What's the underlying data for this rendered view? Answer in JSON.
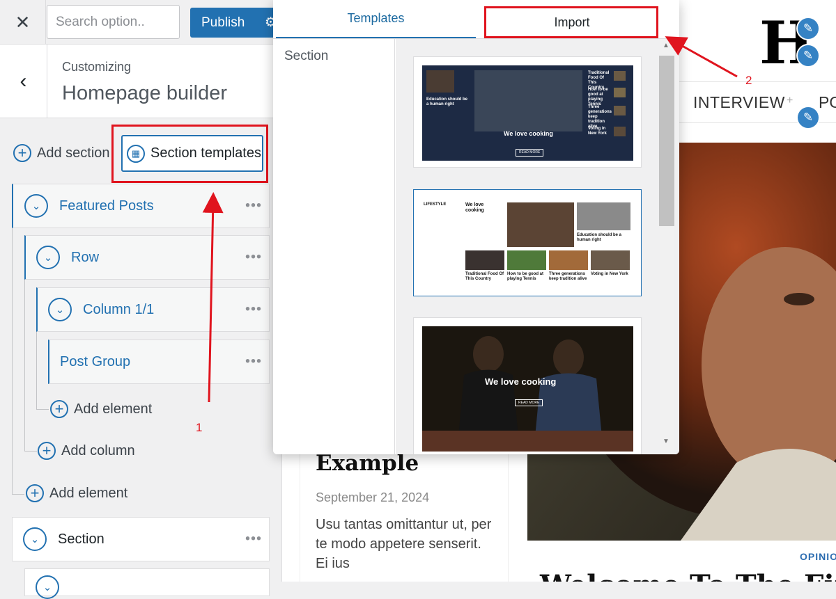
{
  "topbar": {
    "close_label": "✕",
    "search_placeholder": "Search option..",
    "publish_label": "Publish",
    "gear_label": "⚙"
  },
  "header": {
    "back_label": "‹",
    "subtitle": "Customizing",
    "title": "Homepage builder"
  },
  "actions": {
    "add_section": "Add section",
    "section_templates": "Section templates"
  },
  "tree": {
    "featured_posts": "Featured Posts",
    "row": "Row",
    "column": "Column 1/1",
    "post_group": "Post Group",
    "add_element_inner": "Add element",
    "add_column": "Add column",
    "add_element_outer": "Add element",
    "section": "Section",
    "more_label": "•••"
  },
  "popup": {
    "tab_templates": "Templates",
    "tab_import": "Import",
    "category": "Section",
    "templates": [
      {
        "heading": "We love cooking",
        "side_title": "Education should be a human right",
        "list": [
          "Traditional Food Of This Country",
          "How to be good at playing Tennis",
          "Three generations keep tradition alive",
          "Voting in New York"
        ],
        "button": "READ MORE"
      },
      {
        "label": "LIFESTYLE",
        "heading": "We love cooking",
        "side_title": "Education should be a human right",
        "captions": [
          "Traditional Food Of This Country",
          "How to be good at playing Tennis",
          "Three generations keep tradition alive",
          "Voting in New York"
        ]
      },
      {
        "heading": "We love cooking",
        "button": "READ MORE"
      }
    ]
  },
  "preview": {
    "logo": "H",
    "nav_interview": "INTERVIEW",
    "nav_plus": "+",
    "nav_next": "PO",
    "article_title": "Example",
    "article_date": "September 21, 2024",
    "article_excerpt": "Usu tantas omittantur ut, per te modo appetere senserit. Ei ius",
    "category": "OPINIO",
    "bottom_title": "Welcome To The Fir"
  },
  "annotations": {
    "label_1": "1",
    "label_2": "2"
  },
  "colors": {
    "accent": "#2271b1",
    "annotation_red": "#e0141e",
    "template_navy": "#1d2a44"
  }
}
